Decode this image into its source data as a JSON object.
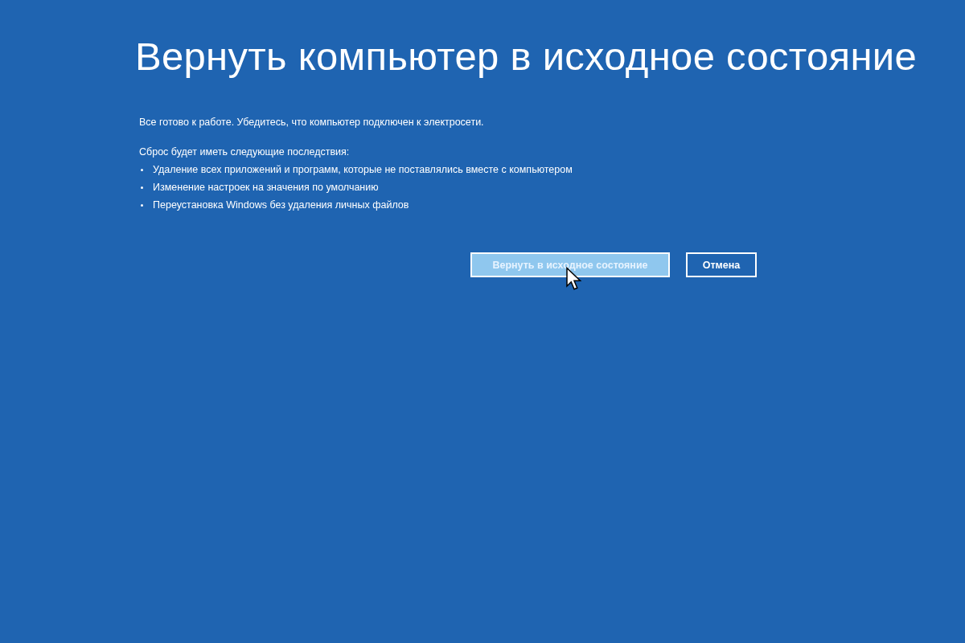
{
  "title": "Вернуть компьютер в исходное состояние",
  "intro": "Все готово к работе. Убедитесь, что компьютер подключен к электросети.",
  "consequences_heading": "Сброс будет иметь следующие последствия:",
  "consequences": [
    "Удаление всех приложений и программ, которые не поставлялись вместе с компьютером",
    "Изменение настроек на значения по умолчанию",
    "Переустановка Windows без удаления личных файлов"
  ],
  "buttons": [
    {
      "label": "Вернуть в исходное состояние",
      "kind": "primary",
      "hovered": true
    },
    {
      "label": "Отмена",
      "kind": "secondary",
      "hovered": false
    }
  ]
}
